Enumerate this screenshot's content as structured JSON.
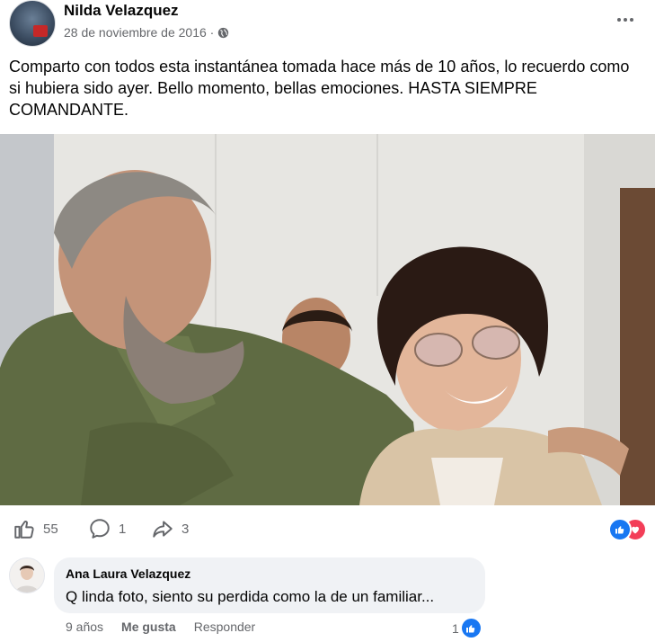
{
  "post": {
    "author": "Nilda Velazquez",
    "date": "28 de noviembre de 2016 ·",
    "audience_icon": "globe-icon",
    "text": "Comparto con todos esta instantánea tomada hace más de 10 años, lo recuerdo como si hubiera sido ayer. Bello momento, bellas emociones. HASTA SIEMPRE COMANDANTE."
  },
  "actions": {
    "like_count": "55",
    "comment_count": "1",
    "share_count": "3"
  },
  "reactions": [
    "like-icon",
    "love-icon"
  ],
  "comment": {
    "author": "Ana Laura Velazquez",
    "text": "Q linda foto, siento su perdida como la de un familiar...",
    "time": "9 años",
    "like_label": "Me gusta",
    "reply_label": "Responder",
    "like_count": "1"
  },
  "colors": {
    "accent": "#1877f2",
    "love": "#f33e58",
    "muted_text": "#65676b",
    "bubble": "#f0f2f5"
  }
}
